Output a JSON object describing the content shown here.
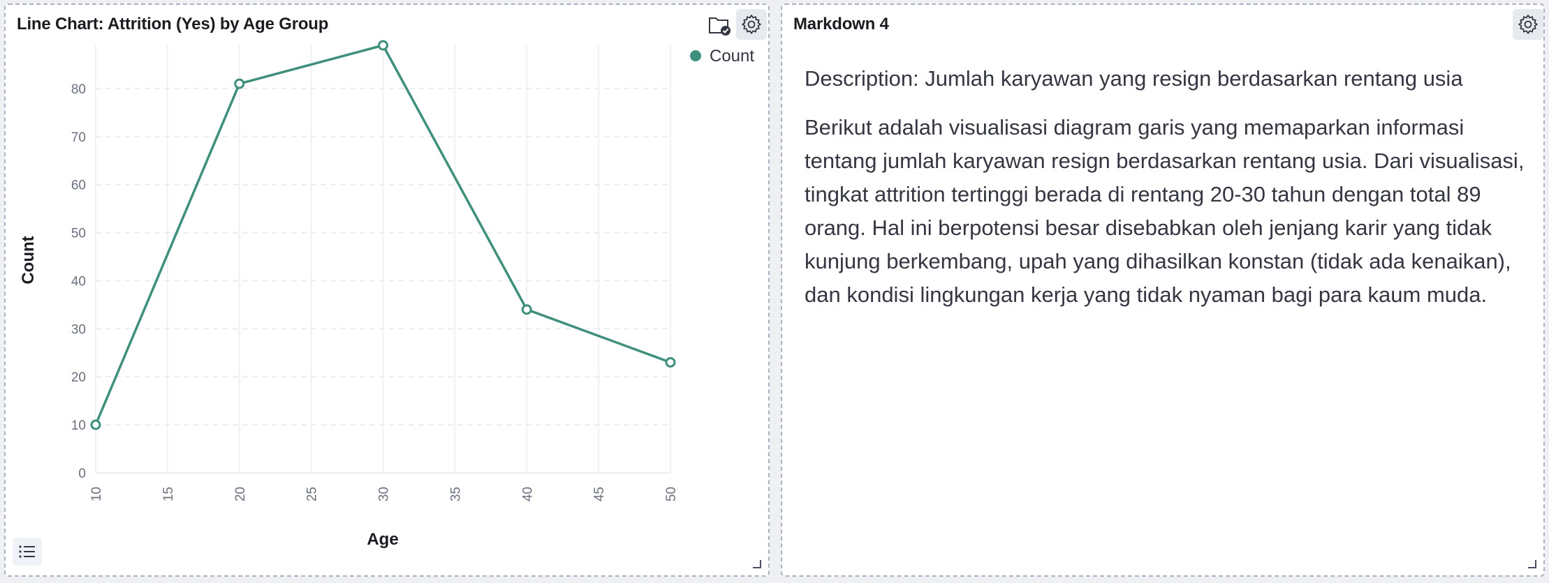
{
  "chart_panel": {
    "title": "Line Chart: Attrition (Yes) by Age Group",
    "icons": [
      "folder-check-icon",
      "gear-icon",
      "list-icon"
    ]
  },
  "chart_data": {
    "type": "line",
    "xlabel": "Age",
    "ylabel": "Count",
    "x": [
      10,
      20,
      30,
      40,
      50
    ],
    "series": [
      {
        "name": "Count",
        "values": [
          10,
          81,
          89,
          34,
          23
        ],
        "color": "#3f8f7d"
      }
    ],
    "xticks": [
      10,
      15,
      20,
      25,
      30,
      35,
      40,
      45,
      50
    ],
    "yticks": [
      0,
      10,
      20,
      30,
      40,
      50,
      60,
      70,
      80
    ],
    "xlim": [
      10,
      50
    ],
    "ylim": [
      0,
      89
    ],
    "grid": true,
    "legend_position": "top-right"
  },
  "markdown_panel": {
    "title": "Markdown 4",
    "heading": "Description: Jumlah karyawan yang resign berdasarkan rentang usia",
    "body": "Berikut adalah visualisasi diagram garis yang memaparkan informasi tentang jumlah karyawan resign berdasarkan rentang usia. Dari visualisasi, tingkat attrition tertinggi berada di rentang 20-30 tahun dengan total 89 orang. Hal ini berpotensi besar disebabkan oleh jenjang karir yang tidak kunjung berkembang, upah yang dihasilkan konstan (tidak ada kenaikan), dan kondisi lingkungan kerja yang tidak nyaman bagi para kaum muda."
  }
}
